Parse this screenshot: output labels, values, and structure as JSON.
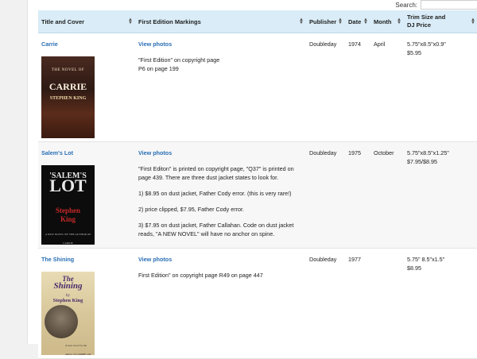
{
  "search": {
    "label": "Search:",
    "value": "",
    "placeholder": ""
  },
  "columns": [
    {
      "label": "Title and Cover"
    },
    {
      "label": "First Edition Markings"
    },
    {
      "label": "Publisher"
    },
    {
      "label": "Date"
    },
    {
      "label": "Month"
    },
    {
      "label": "Trim Size and DJ Price"
    }
  ],
  "rows": [
    {
      "title": "Carrie",
      "photos_link": "View photos",
      "markings": [
        "\"First Edition\" on copyright page",
        "P6 on page 199"
      ],
      "publisher": "Doubleday",
      "date": "1974",
      "month": "April",
      "trim": "5.75\"x8.5\"x0.9\"",
      "price": "$5.95",
      "cover_text": [
        "CARRIE",
        "STEPHEN KING"
      ]
    },
    {
      "title": "Salem's Lot",
      "photos_link": "View photos",
      "markings": [
        "\"First Editon\" is printed on copyright page, \"Q37\" is printed on page 439. There are three dust jacket states to look for.",
        "1) $8.95 on dust jacket, Father Cody error. (this is very rare!)",
        "2) price clipped, $7.95, Father Cody error.",
        "3) $7.95 on dust jacket, Father Callahan. Code on dust jacket reads, \"A NEW NOVEL\" will have no anchor on spine."
      ],
      "publisher": "Doubleday",
      "date": "1975",
      "month": "October",
      "trim": "5.75\"x8.5\"x1.25\"",
      "price": "$7.95/$8.95",
      "cover_text": [
        "'SALEM'S",
        "LOT",
        "Stephen",
        "King"
      ]
    },
    {
      "title": "The Shining",
      "photos_link": "View photos",
      "markings": [
        "First Edition\" on copyright page R49 on page 447"
      ],
      "publisher": "Doubleday",
      "date": "1977",
      "month": "",
      "trim": "5.75\" 8.5\"x1.5\"",
      "price": "$8.95",
      "cover_text": [
        "The",
        "Shining",
        "by",
        "Stephen King"
      ]
    }
  ],
  "colors": {
    "header_bg": "#d9ecf7",
    "link": "#2a6fb5"
  }
}
